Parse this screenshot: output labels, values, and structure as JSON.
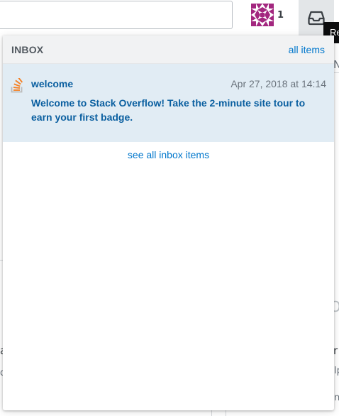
{
  "topbar": {
    "search_value": "",
    "reputation": "1",
    "tooltip": "Re"
  },
  "inbox": {
    "title": "INBOX",
    "all_items_link": "all items",
    "items": [
      {
        "source": "welcome",
        "date": "Apr 27, 2018 at 14:14",
        "body": "Welcome to Stack Overflow! Take the 2-minute site tour to earn your first badge.",
        "icon": "stackoverflow-logo-icon",
        "unread": true
      }
    ],
    "see_all_link": "see all inbox items"
  },
  "background": {
    "frag_top_right": "N",
    "frag_mid_right": "O",
    "frag_left_a": "a",
    "frag_left_d": "d",
    "frag_right_r": "r",
    "frag_right_lp": "lp",
    "frag_right_n": "n"
  },
  "colors": {
    "accent": "#0077cc",
    "item_text": "#0a5fa0",
    "unread_bg": "#e1ecf4",
    "header_bg": "#f1f2f3",
    "inbox_button_bg": "#e3e6e8",
    "avatar_magenta": "#a3277f"
  }
}
